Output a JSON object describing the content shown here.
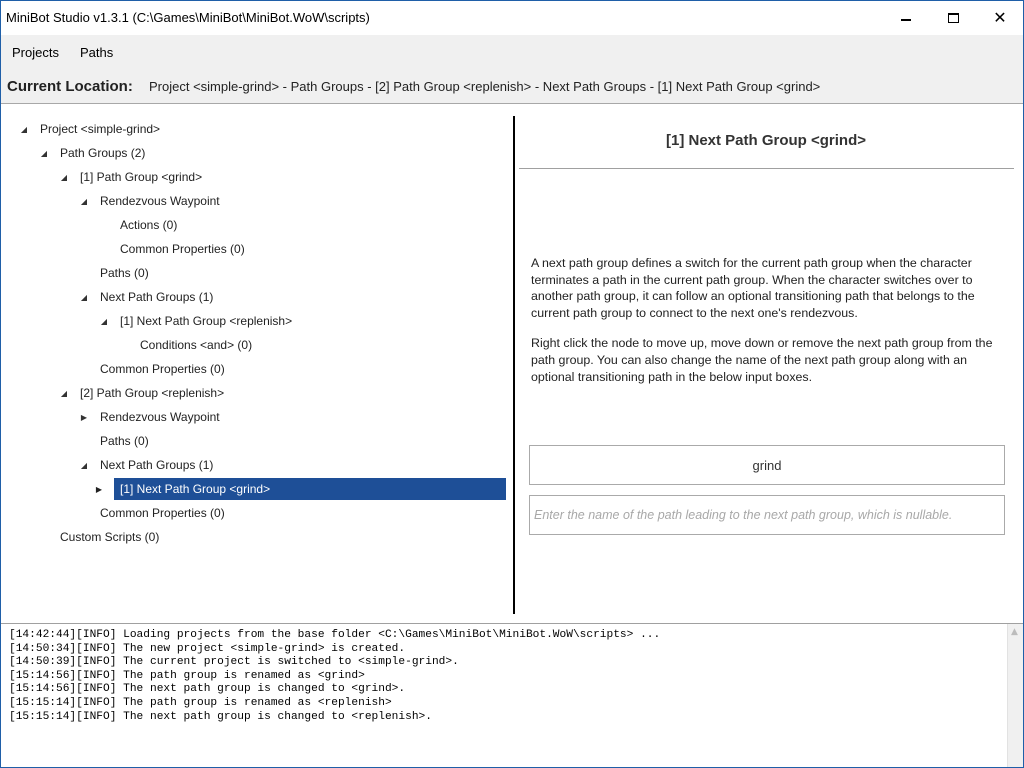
{
  "window": {
    "title": "MiniBot Studio v1.3.1 (C:\\Games\\MiniBot\\MiniBot.WoW\\scripts)",
    "controls": {
      "minimize": "—",
      "maximize": "☐",
      "close": "✕"
    }
  },
  "menu": {
    "items": [
      {
        "label": "Projects"
      },
      {
        "label": "Paths"
      }
    ]
  },
  "location": {
    "label": "Current Location:",
    "path": "Project <simple-grind> - Path Groups - [2] Path Group <replenish> - Next Path Groups - [1] Next Path Group <grind>"
  },
  "tree": {
    "nodes": [
      {
        "label": "Project <simple-grind>",
        "expander": "expanded"
      },
      {
        "label": "Path Groups (2)",
        "expander": "expanded"
      },
      {
        "label": "[1] Path Group <grind>",
        "expander": "expanded"
      },
      {
        "label": "Rendezvous Waypoint",
        "expander": "expanded"
      },
      {
        "label": "Actions (0)",
        "expander": "none"
      },
      {
        "label": "Common Properties (0)",
        "expander": "none"
      },
      {
        "label": "Paths (0)",
        "expander": "none"
      },
      {
        "label": "Next Path Groups (1)",
        "expander": "expanded"
      },
      {
        "label": "[1] Next Path Group <replenish>",
        "expander": "expanded"
      },
      {
        "label": "Conditions <and> (0)",
        "expander": "none"
      },
      {
        "label": "Common Properties (0)",
        "expander": "none"
      },
      {
        "label": "[2] Path Group <replenish>",
        "expander": "expanded"
      },
      {
        "label": "Rendezvous Waypoint",
        "expander": "collapsed"
      },
      {
        "label": "Paths (0)",
        "expander": "none"
      },
      {
        "label": "Next Path Groups (1)",
        "expander": "expanded"
      },
      {
        "label": "[1] Next Path Group <grind>",
        "expander": "collapsed",
        "selected": true
      },
      {
        "label": "Common Properties (0)",
        "expander": "none"
      },
      {
        "label": "Custom Scripts (0)",
        "expander": "none"
      }
    ]
  },
  "detail": {
    "title": "[1] Next Path Group <grind>",
    "description_1": "A next path group defines a switch for the current path group when the character terminates a path in the current path group. When the character switches over to another path group, it can follow an optional transitioning path that belongs to the current path group to connect to the next one's rendezvous.",
    "description_2": "Right click the node to move up, move down or remove the next path group from the path group. You can also change the name of the next path group along with an optional transitioning path in the below input boxes.",
    "name_value": "grind",
    "path_placeholder": "Enter the name of the path leading to the next path group, which is nullable."
  },
  "log": {
    "lines": [
      "[14:42:44][INFO] Loading projects from the base folder <C:\\Games\\MiniBot\\MiniBot.WoW\\scripts> ...",
      "[14:50:34][INFO] The new project <simple-grind> is created.",
      "[14:50:39][INFO] The current project is switched to <simple-grind>.",
      "[15:14:56][INFO] The path group is renamed as <grind>",
      "[15:14:56][INFO] The next path group is changed to <grind>.",
      "[15:15:14][INFO] The path group is renamed as <replenish>",
      "[15:15:14][INFO] The next path group is changed to <replenish>."
    ]
  },
  "colors": {
    "selection": "#1e4f97",
    "window_border": "#1f5fa8",
    "toolbar_bg": "#f0f0f0"
  }
}
